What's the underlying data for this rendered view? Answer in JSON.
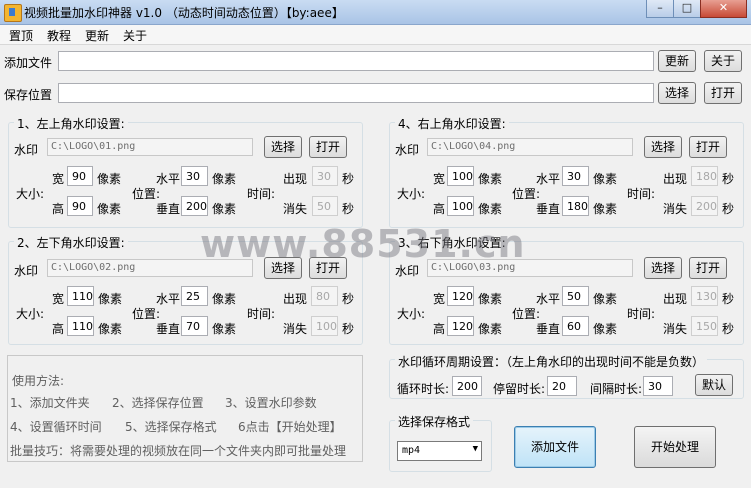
{
  "window": {
    "title": "视频批量加水印神器 v1.0 （动态时间动态位置）【by:aee】",
    "minimize": "–",
    "maximize": "□",
    "close": "✕"
  },
  "menu": [
    "置顶",
    "教程",
    "更新",
    "关于"
  ],
  "top": {
    "add_file_label": "添加文件",
    "save_location_label": "保存位置",
    "update_btn": "更新",
    "about_btn": "关于",
    "choose_btn": "选择",
    "open_btn": "打开"
  },
  "common": {
    "watermark": "水印",
    "size": "大小:",
    "width": "宽",
    "height": "高",
    "px": "像素",
    "horizontal": "水平",
    "vertical": "垂直",
    "position": "位置:",
    "time": "时间:",
    "appear": "出现",
    "disappear": "消失",
    "sec": "秒",
    "choose": "选择",
    "open": "打开"
  },
  "panels": {
    "tl": {
      "title": "1、左上角水印设置:",
      "path": "C:\\LOGO\\01.png",
      "w": "90",
      "h": "90",
      "x": "30",
      "y": "200",
      "appear": "30",
      "disappear": "50"
    },
    "tr": {
      "title": "4、右上角水印设置:",
      "path": "C:\\LOGO\\04.png",
      "w": "100",
      "h": "100",
      "x": "30",
      "y": "180",
      "appear": "180",
      "disappear": "200"
    },
    "bl": {
      "title": "2、左下角水印设置:",
      "path": "C:\\LOGO\\02.png",
      "w": "110",
      "h": "110",
      "x": "25",
      "y": "70",
      "appear": "80",
      "disappear": "100"
    },
    "br": {
      "title": "3、右下角水印设置:",
      "path": "C:\\LOGO\\03.png",
      "w": "120",
      "h": "120",
      "x": "50",
      "y": "60",
      "appear": "130",
      "disappear": "150"
    }
  },
  "watermark_text": "www.88531.cn",
  "usage": {
    "title": "使用方法:",
    "step1": "1、添加文件夹",
    "step2": "2、选择保存位置",
    "step3": "3、设置水印参数",
    "step4": "4、设置循环时间",
    "step5": "5、选择保存格式",
    "step6": "6点击【开始处理】",
    "tip": "批量技巧：将需要处理的视频放在同一个文件夹内即可批量处理"
  },
  "cycle": {
    "title": "水印循环周期设置：（左上角水印的出现时间不能是负数）",
    "loop_label": "循环时长:",
    "loop_value": "200",
    "stay_label": "停留时长:",
    "stay_value": "20",
    "interval_label": "间隔时长:",
    "interval_value": "30",
    "default_btn": "默认"
  },
  "format": {
    "title": "选择保存格式",
    "selected": "mp4"
  },
  "actions": {
    "add_file": "添加文件",
    "start": "开始处理"
  }
}
